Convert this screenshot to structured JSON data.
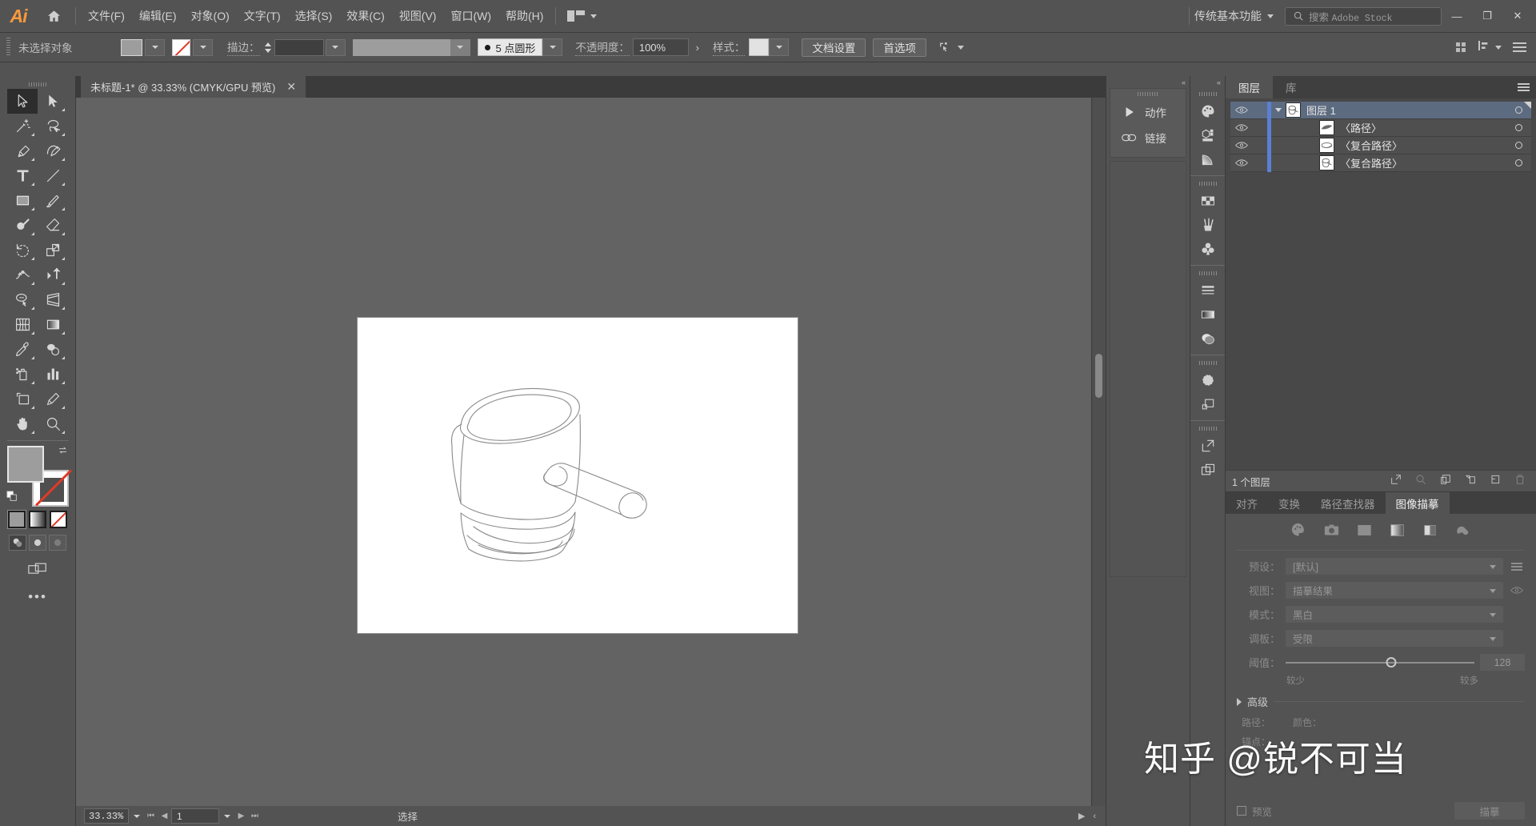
{
  "app": {
    "logo": "Ai",
    "title": "Adobe Illustrator"
  },
  "menubar": {
    "items": [
      {
        "label": "文件(F)"
      },
      {
        "label": "编辑(E)"
      },
      {
        "label": "对象(O)"
      },
      {
        "label": "文字(T)"
      },
      {
        "label": "选择(S)"
      },
      {
        "label": "效果(C)"
      },
      {
        "label": "视图(V)"
      },
      {
        "label": "窗口(W)"
      },
      {
        "label": "帮助(H)"
      }
    ],
    "workspace": "传统基本功能",
    "search_placeholder_prefix": "搜索",
    "search_placeholder_suffix": "Adobe Stock",
    "window_buttons": {
      "minimize": "—",
      "maximize": "❐",
      "close": "✕"
    }
  },
  "controlbar": {
    "selection_status": "未选择对象",
    "stroke_label": "描边：",
    "stroke_weight": "",
    "profile": "5 点圆形",
    "opacity_label": "不透明度：",
    "opacity_value": "100%",
    "style_label": "样式：",
    "document_setup": "文档设置",
    "preferences": "首选项"
  },
  "document": {
    "tab_title": "未标题-1* @ 33.33% (CMYK/GPU 预览)",
    "close_glyph": "✕"
  },
  "statusbar": {
    "zoom": "33.33%",
    "page": "1",
    "tool_status": "选择"
  },
  "left_toolbar": {
    "tools": [
      {
        "name": "selection-tool",
        "active": true
      },
      {
        "name": "direct-selection-tool",
        "active": false
      },
      {
        "name": "magic-wand-tool",
        "active": false
      },
      {
        "name": "lasso-tool",
        "active": false
      },
      {
        "name": "pen-tool",
        "active": false
      },
      {
        "name": "curvature-tool",
        "active": false
      },
      {
        "name": "type-tool",
        "active": false
      },
      {
        "name": "line-segment-tool",
        "active": false
      },
      {
        "name": "rectangle-tool",
        "active": false
      },
      {
        "name": "paintbrush-tool",
        "active": false
      },
      {
        "name": "shaper-tool",
        "active": false
      },
      {
        "name": "eraser-tool",
        "active": false
      },
      {
        "name": "rotate-tool",
        "active": false
      },
      {
        "name": "scale-tool",
        "active": false
      },
      {
        "name": "width-tool",
        "active": false
      },
      {
        "name": "free-transform-tool",
        "active": false
      },
      {
        "name": "shape-builder-tool",
        "active": false
      },
      {
        "name": "perspective-grid-tool",
        "active": false
      },
      {
        "name": "mesh-tool",
        "active": false
      },
      {
        "name": "gradient-tool",
        "active": false
      },
      {
        "name": "eyedropper-tool",
        "active": false
      },
      {
        "name": "blend-tool",
        "active": false
      },
      {
        "name": "symbol-sprayer-tool",
        "active": false
      },
      {
        "name": "column-graph-tool",
        "active": false
      },
      {
        "name": "artboard-tool",
        "active": false
      },
      {
        "name": "slice-tool",
        "active": false
      },
      {
        "name": "hand-tool",
        "active": false
      },
      {
        "name": "zoom-tool",
        "active": false
      }
    ],
    "fill_color": "#9d9d9d",
    "stroke_color": "none",
    "paint_modes": [
      "color",
      "gradient",
      "none"
    ],
    "draw_modes": [
      "draw-normal",
      "draw-behind",
      "draw-inside"
    ],
    "more_tools": "•••"
  },
  "dock": {
    "mini_panels": [
      {
        "label": "动作",
        "icon": "play-icon"
      },
      {
        "label": "链接",
        "icon": "link-icon"
      }
    ],
    "icon_groups": [
      [
        "color-panel-icon",
        "color-guide-icon",
        "gradient-panel-icon"
      ],
      [
        "swatches-panel-icon",
        "brushes-panel-icon",
        "symbols-panel-icon"
      ],
      [
        "stroke-panel-icon",
        "gradient-bar-icon",
        "transparency-panel-icon"
      ],
      [
        "appearance-panel-icon",
        "graphic-styles-icon"
      ],
      [
        "export-panel-icon",
        "artboards-panel-icon"
      ]
    ]
  },
  "layers_panel": {
    "tabs": [
      {
        "label": "图层",
        "active": true
      },
      {
        "label": "库",
        "active": false
      }
    ],
    "rows": [
      {
        "name": "图层 1",
        "type": "layer",
        "selected": true,
        "visible": true,
        "expanded": true,
        "thumb": "pot-icon"
      },
      {
        "name": "〈路径〉",
        "type": "path",
        "selected": false,
        "visible": true,
        "thumb": "path-icon"
      },
      {
        "name": "〈复合路径〉",
        "type": "compound-path",
        "selected": false,
        "visible": true,
        "thumb": "compound-icon"
      },
      {
        "name": "〈复合路径〉",
        "type": "compound-path",
        "selected": false,
        "visible": true,
        "thumb": "pot-icon"
      }
    ],
    "footer_count": "1 个图层",
    "footer_buttons": [
      "locate-object-icon",
      "make-clipping-mask-icon",
      "create-new-sublayer-icon",
      "create-new-layer-icon",
      "delete-selection-icon"
    ],
    "selection_color": "#5b7fd4"
  },
  "trace_panel": {
    "tabs": [
      {
        "label": "对齐",
        "active": false
      },
      {
        "label": "变换",
        "active": false
      },
      {
        "label": "路径查找器",
        "active": false
      },
      {
        "label": "图像描摹",
        "active": true
      }
    ],
    "mode_buttons": [
      "auto-color-icon",
      "high-color-icon",
      "low-color-icon",
      "grayscale-icon",
      "black-and-white-icon",
      "outline-icon"
    ],
    "preset_label": "预设：",
    "preset_value": "[默认]",
    "view_label": "视图：",
    "view_value": "描摹结果",
    "mode_label": "模式：",
    "mode_value": "黑白",
    "palette_label": "调板：",
    "palette_value": "受限",
    "threshold_label": "阈值：",
    "threshold_value": "128",
    "threshold_min_label": "较少",
    "threshold_max_label": "较多",
    "advanced_label": "高级",
    "info_paths_label": "路径：",
    "info_paths_value": "",
    "info_anchors_label": "锚点：",
    "info_anchors_value": "",
    "info_colors_label": "颜色：",
    "info_colors_value": "",
    "preview_label": "预览",
    "trace_button": "描摹"
  },
  "watermark": {
    "text": "知乎 @锐不可当"
  },
  "artwork": {
    "description": "line drawing of a saucepan / milk pot with a cylindrical handle",
    "stroke_color": "#8a8a8a",
    "background": "#ffffff"
  }
}
